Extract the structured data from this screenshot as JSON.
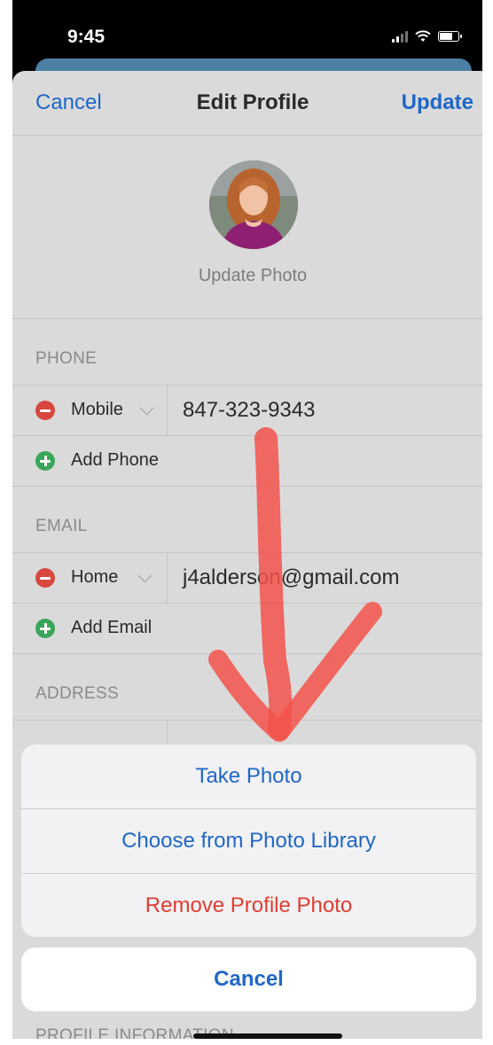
{
  "status_bar": {
    "time": "9:45"
  },
  "nav": {
    "cancel_label": "Cancel",
    "title": "Edit Profile",
    "update_label": "Update"
  },
  "photo": {
    "update_label": "Update Photo"
  },
  "phone_section": {
    "header": "PHONE",
    "entry": {
      "label": "Mobile",
      "value": "847-323-9343"
    },
    "add_label": "Add Phone"
  },
  "email_section": {
    "header": "EMAIL",
    "entry": {
      "label": "Home",
      "value": "j4alderson@gmail.com"
    },
    "add_label": "Add Email"
  },
  "address_section": {
    "header": "ADDRESS"
  },
  "action_sheet": {
    "take_photo": "Take Photo",
    "choose_library": "Choose from Photo Library",
    "remove_photo": "Remove Profile Photo",
    "cancel": "Cancel"
  },
  "profile_info_header": "PROFILE INFORMATION",
  "colors": {
    "link_blue": "#1f67c7",
    "destructive_red": "#e23b30",
    "annotation_red": "#f2524a",
    "add_green": "#3aa55a",
    "remove_red": "#d8463f"
  },
  "icons": [
    "signal-icon",
    "wifi-icon",
    "battery-icon",
    "minus-circle-icon",
    "plus-circle-icon",
    "chevron-down-icon"
  ]
}
